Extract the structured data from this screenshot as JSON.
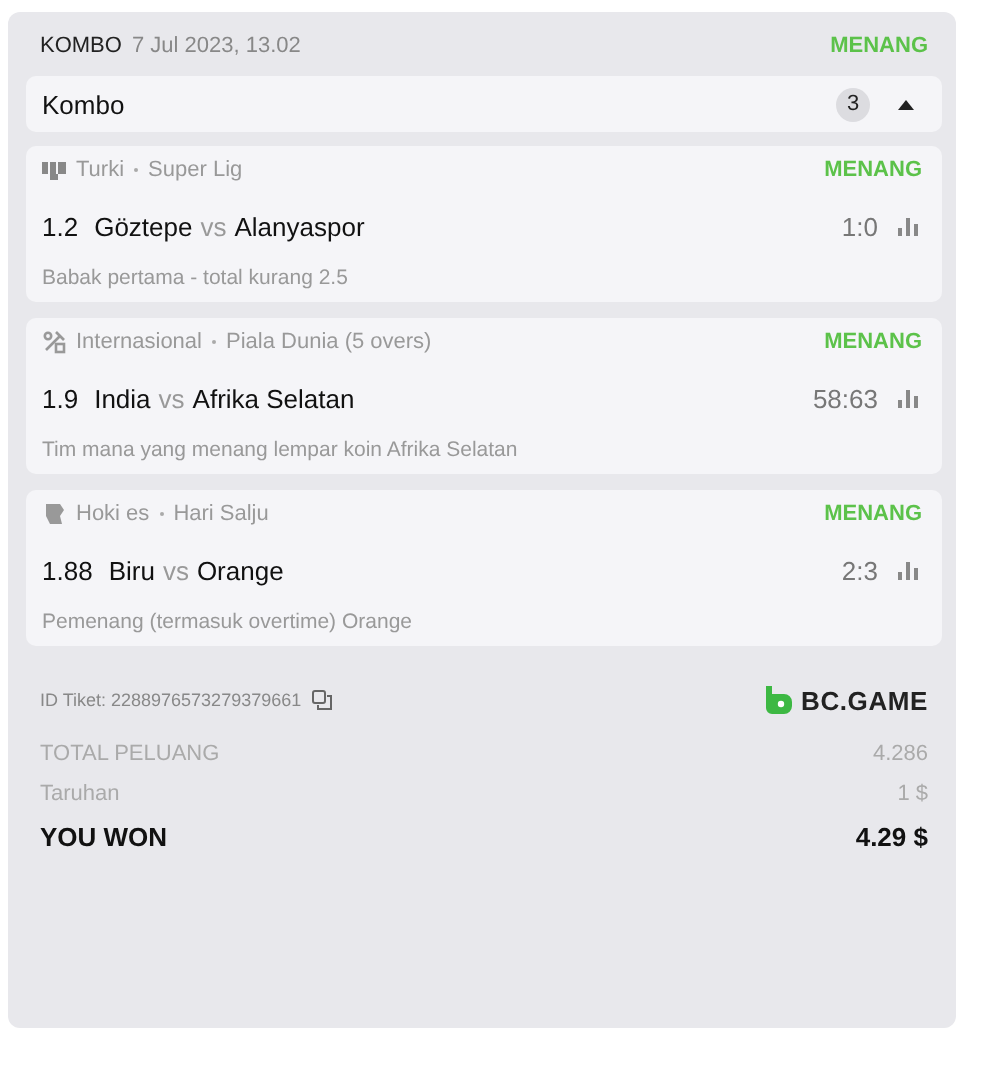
{
  "header": {
    "type": "KOMBO",
    "date": "7 Jul 2023, 13.02",
    "status": "MENANG"
  },
  "combo": {
    "title": "Kombo",
    "count": "3",
    "expanded": true
  },
  "bets": [
    {
      "kind": "football",
      "region": "Turki",
      "league": "Super Lig",
      "status": "MENANG",
      "odds": "1.2",
      "home": "Göztepe",
      "vs": "vs",
      "away": "Alanyaspor",
      "score": "1:0",
      "market": "Babak pertama - total kurang 2.5"
    },
    {
      "kind": "cricket",
      "region": "Internasional",
      "league": "Piala Dunia (5 overs)",
      "status": "MENANG",
      "odds": "1.9",
      "home": "India",
      "vs": "vs",
      "away": "Afrika Selatan",
      "score": "58:63",
      "market": "Tim mana yang menang lempar koin Afrika Selatan"
    },
    {
      "kind": "hockey",
      "region": "Hoki es",
      "league": "Hari Salju",
      "status": "MENANG",
      "odds": "1.88",
      "home": "Biru",
      "vs": "vs",
      "away": "Orange",
      "score": "2:3",
      "market": "Pemenang (termasuk overtime) Orange"
    }
  ],
  "ticket": {
    "label": "ID Tiket:",
    "id": "2288976573279379661"
  },
  "brand": "BC.GAME",
  "totals": [
    {
      "kind": "muted",
      "label": "TOTAL PELUANG",
      "value": "4.286"
    },
    {
      "kind": "muted",
      "label": "Taruhan",
      "value": "1 $"
    },
    {
      "kind": "strong",
      "label": "YOU WON",
      "value": "4.29 $"
    }
  ]
}
